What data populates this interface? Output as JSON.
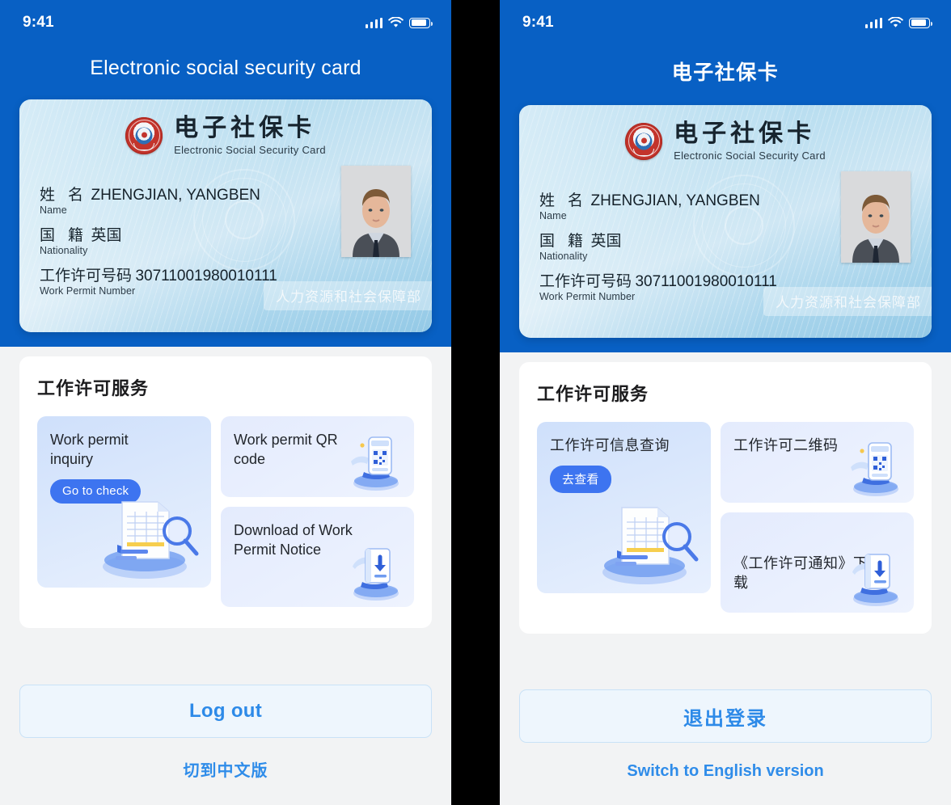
{
  "status_bar": {
    "time": "9:41",
    "signal_icon": "cellular-bars-icon",
    "wifi_icon": "wifi-icon",
    "battery_icon": "battery-icon"
  },
  "panels": {
    "english": {
      "app_title": "Electronic social security card",
      "card": {
        "emblem_icon": "social-security-card-emblem-icon",
        "title_cn": "电子社保卡",
        "title_en": "Electronic Social Security Card",
        "fields": [
          {
            "label_cn": "姓 名",
            "label_en": "Name",
            "value": "ZHENGJIAN, YANGBEN"
          },
          {
            "label_cn": "国 籍",
            "label_en": "Nationality",
            "value": "英国"
          },
          {
            "label_cn": "工作许可号码",
            "label_en": "Work Permit Number",
            "value": "30711001980010111"
          }
        ],
        "ministry": "人力资源和社会保障部",
        "photo_icon": "portrait-photo"
      },
      "services": {
        "title": "工作许可服务",
        "primary_tile": {
          "label": "Work permit inquiry",
          "badge": "Go to check",
          "illustration_icon": "document-magnifier-icon"
        },
        "tiles": [
          {
            "label": "Work permit QR code",
            "illustration_icon": "qr-scanner-icon"
          },
          {
            "label": "Download of Work Permit Notice",
            "illustration_icon": "download-document-icon"
          }
        ]
      },
      "footer": {
        "logout": "Log out",
        "switch_language": "切到中文版"
      }
    },
    "chinese": {
      "app_title": "电子社保卡",
      "card": {
        "emblem_icon": "social-security-card-emblem-icon",
        "title_cn": "电子社保卡",
        "title_en": "Electronic Social Security Card",
        "fields": [
          {
            "label_cn": "姓 名",
            "label_en": "Name",
            "value": "ZHENGJIAN, YANGBEN"
          },
          {
            "label_cn": "国 籍",
            "label_en": "Nationality",
            "value": "英国"
          },
          {
            "label_cn": "工作许可号码",
            "label_en": "Work Permit Number",
            "value": "30711001980010111"
          }
        ],
        "ministry": "人力资源和社会保障部",
        "photo_icon": "portrait-photo"
      },
      "services": {
        "title": "工作许可服务",
        "primary_tile": {
          "label": "工作许可信息查询",
          "badge": "去查看",
          "illustration_icon": "document-magnifier-icon"
        },
        "tiles": [
          {
            "label": "工作许可二维码",
            "illustration_icon": "qr-scanner-icon"
          },
          {
            "label": "《工作许可通知》下载",
            "illustration_icon": "download-document-icon"
          }
        ]
      },
      "footer": {
        "logout": "退出登录",
        "switch_language": "Switch to English version"
      }
    }
  },
  "colors": {
    "header_blue": "#0860c4",
    "accent_blue": "#3d74f0",
    "link_blue": "#2f8ce9",
    "page_bg": "#f2f3f4"
  }
}
